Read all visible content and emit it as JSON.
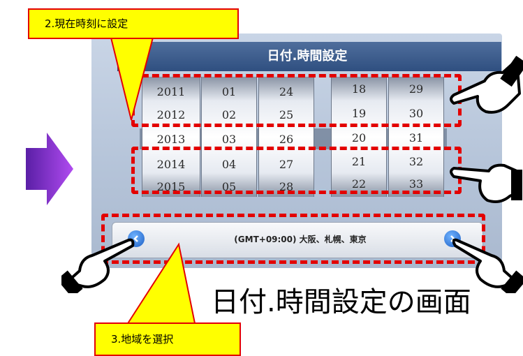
{
  "callouts": {
    "set_time": "2.現在時刻に設定",
    "select_region": "3.地域を選択"
  },
  "screen": {
    "title": "日付.時間設定",
    "back_icon": "left-arrow-icon",
    "wheels": {
      "year": [
        "2011",
        "2012",
        "2013",
        "2014",
        "2015"
      ],
      "month": [
        "01",
        "02",
        "03",
        "04",
        "05"
      ],
      "day": [
        "24",
        "25",
        "26",
        "27",
        "28"
      ],
      "hour": [
        "18",
        "19",
        "20",
        "21",
        "22"
      ],
      "minute": [
        "29",
        "30",
        "31",
        "32",
        "33"
      ]
    },
    "timezone": "(GMT+09:00) 大阪、札幌、東京",
    "prev_icon": "chevron-left-icon",
    "next_icon": "chevron-right-icon"
  },
  "caption": "日付.時間設定の画面",
  "colors": {
    "highlight": "#e30000",
    "callout": "#ffff00",
    "arrow": "#8b2fd6",
    "titlebar": "#3b5a8a"
  }
}
